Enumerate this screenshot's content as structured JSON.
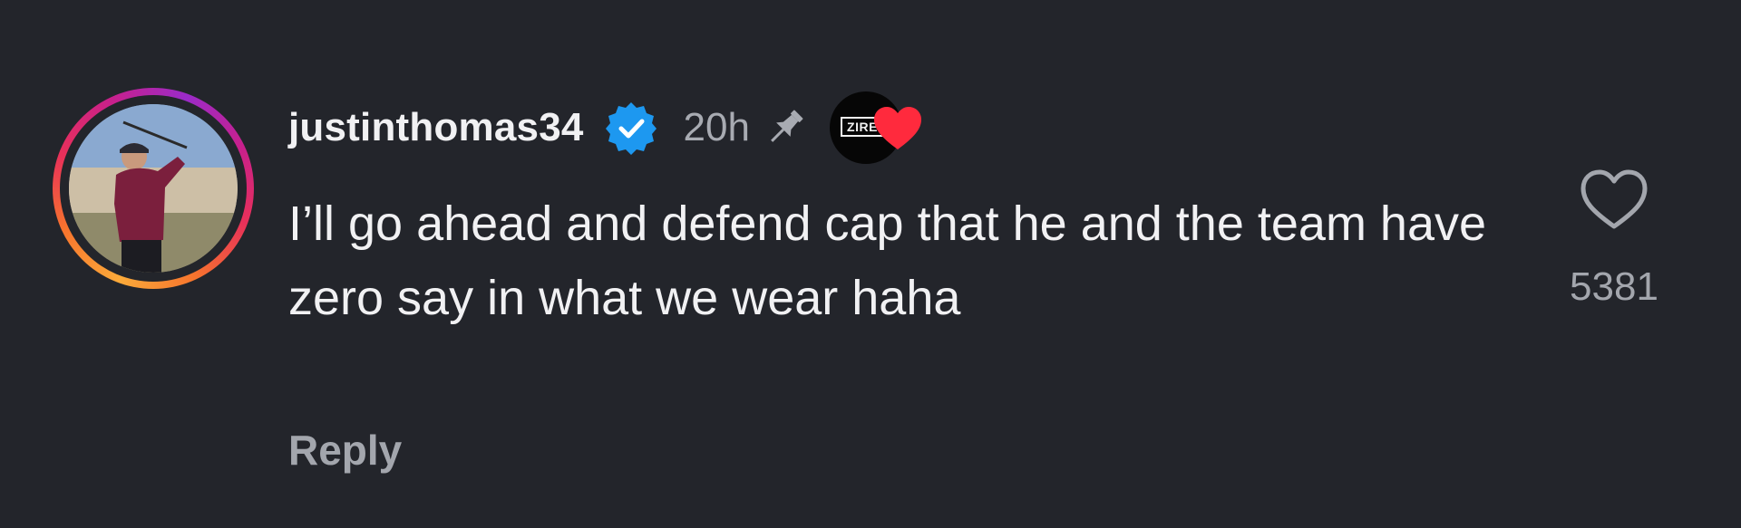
{
  "comment": {
    "username": "justinthomas34",
    "verified_icon": "verified-badge-icon",
    "time": "20h",
    "pin_icon": "pin-icon",
    "badge": {
      "text": "ZIRE",
      "heart_color": "#ff2a3d"
    },
    "text": "I’ll go ahead and defend cap that he and the team have zero say in what we wear haha",
    "reply_label": "Reply",
    "like_icon": "heart-outline-icon",
    "like_count": "5381"
  },
  "colors": {
    "background": "#23252b",
    "primary_text": "#f1f1f3",
    "secondary_text": "#a3a6ad",
    "verified_blue": "#1d98f0"
  }
}
